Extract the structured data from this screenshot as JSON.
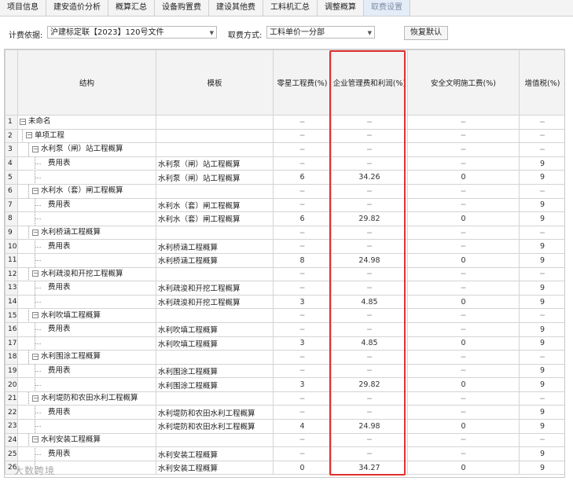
{
  "tabs": [
    "项目信息",
    "建安造价分析",
    "概算汇总",
    "设备购置费",
    "建设其他费",
    "工料机汇总",
    "调整概算",
    "取费设置"
  ],
  "active_tab": 7,
  "toolbar": {
    "basis_label": "计费依据:",
    "basis_value": "沪建标定联【2023】120号文件",
    "method_label": "取费方式:",
    "method_value": "工料单价一分部",
    "restore_button": "恢复默认"
  },
  "table": {
    "headers": [
      "结构",
      "模板",
      "零星工程费(%)",
      "企业管理费和利润(%)",
      "安全文明施工费(%)",
      "增值税(%)"
    ],
    "rows": [
      {
        "n": "1",
        "level": 0,
        "box": "−",
        "name": "未命名",
        "tpl": "",
        "v1": "−",
        "v2": "−",
        "v3": "−",
        "v4": "−"
      },
      {
        "n": "2",
        "level": 1,
        "box": "−",
        "name": "单项工程",
        "tpl": "",
        "v1": "−",
        "v2": "−",
        "v3": "−",
        "v4": "−"
      },
      {
        "n": "3",
        "level": 2,
        "box": "−",
        "name": "水利泵（闸）站工程概算",
        "tpl": "",
        "v1": "−",
        "v2": "−",
        "v3": "−",
        "v4": "−"
      },
      {
        "n": "4",
        "level": 3,
        "box": "",
        "name": "费用表",
        "tpl": "水利泵（闸）站工程概算",
        "v1": "−",
        "v2": "−",
        "v3": "−",
        "v4": "9"
      },
      {
        "n": "5",
        "level": 3,
        "box": "",
        "name": "",
        "tpl": "水利泵（闸）站工程概算",
        "v1": "6",
        "v2": "34.26",
        "v3": "0",
        "v4": "9"
      },
      {
        "n": "6",
        "level": 2,
        "box": "−",
        "name": "水利水（套）闸工程概算",
        "tpl": "",
        "v1": "−",
        "v2": "−",
        "v3": "−",
        "v4": "−"
      },
      {
        "n": "7",
        "level": 3,
        "box": "",
        "name": "费用表",
        "tpl": "水利水（套）闸工程概算",
        "v1": "−",
        "v2": "−",
        "v3": "−",
        "v4": "9"
      },
      {
        "n": "8",
        "level": 3,
        "box": "",
        "name": "",
        "tpl": "水利水（套）闸工程概算",
        "v1": "6",
        "v2": "29.82",
        "v3": "0",
        "v4": "9"
      },
      {
        "n": "9",
        "level": 2,
        "box": "−",
        "name": "水利桥涵工程概算",
        "tpl": "",
        "v1": "−",
        "v2": "−",
        "v3": "−",
        "v4": "−"
      },
      {
        "n": "10",
        "level": 3,
        "box": "",
        "name": "费用表",
        "tpl": "水利桥涵工程概算",
        "v1": "−",
        "v2": "−",
        "v3": "−",
        "v4": "9"
      },
      {
        "n": "11",
        "level": 3,
        "box": "",
        "name": "",
        "tpl": "水利桥涵工程概算",
        "v1": "8",
        "v2": "24.98",
        "v3": "0",
        "v4": "9"
      },
      {
        "n": "12",
        "level": 2,
        "box": "−",
        "name": "水利疏浚和开挖工程概算",
        "tpl": "",
        "v1": "−",
        "v2": "−",
        "v3": "−",
        "v4": "−"
      },
      {
        "n": "13",
        "level": 3,
        "box": "",
        "name": "费用表",
        "tpl": "水利疏浚和开挖工程概算",
        "v1": "−",
        "v2": "−",
        "v3": "−",
        "v4": "9"
      },
      {
        "n": "14",
        "level": 3,
        "box": "",
        "name": "",
        "tpl": "水利疏浚和开挖工程概算",
        "v1": "3",
        "v2": "4.85",
        "v3": "0",
        "v4": "9"
      },
      {
        "n": "15",
        "level": 2,
        "box": "−",
        "name": "水利吹填工程概算",
        "tpl": "",
        "v1": "−",
        "v2": "−",
        "v3": "−",
        "v4": "−"
      },
      {
        "n": "16",
        "level": 3,
        "box": "",
        "name": "费用表",
        "tpl": "水利吹填工程概算",
        "v1": "−",
        "v2": "−",
        "v3": "−",
        "v4": "9"
      },
      {
        "n": "17",
        "level": 3,
        "box": "",
        "name": "",
        "tpl": "水利吹填工程概算",
        "v1": "3",
        "v2": "4.85",
        "v3": "0",
        "v4": "9"
      },
      {
        "n": "18",
        "level": 2,
        "box": "−",
        "name": "水利围涂工程概算",
        "tpl": "",
        "v1": "−",
        "v2": "−",
        "v3": "−",
        "v4": "−"
      },
      {
        "n": "19",
        "level": 3,
        "box": "",
        "name": "费用表",
        "tpl": "水利围涂工程概算",
        "v1": "−",
        "v2": "−",
        "v3": "−",
        "v4": "9"
      },
      {
        "n": "20",
        "level": 3,
        "box": "",
        "name": "",
        "tpl": "水利围涂工程概算",
        "v1": "3",
        "v2": "29.82",
        "v3": "0",
        "v4": "9"
      },
      {
        "n": "21",
        "level": 2,
        "box": "−",
        "name": "水利堤防和农田水利工程概算",
        "tpl": "",
        "v1": "−",
        "v2": "−",
        "v3": "−",
        "v4": "−"
      },
      {
        "n": "22",
        "level": 3,
        "box": "",
        "name": "费用表",
        "tpl": "水利堤防和农田水利工程概算",
        "v1": "−",
        "v2": "−",
        "v3": "−",
        "v4": "9"
      },
      {
        "n": "23",
        "level": 3,
        "box": "",
        "name": "",
        "tpl": "水利堤防和农田水利工程概算",
        "v1": "4",
        "v2": "24.98",
        "v3": "0",
        "v4": "9"
      },
      {
        "n": "24",
        "level": 2,
        "box": "−",
        "name": "水利安装工程概算",
        "tpl": "",
        "v1": "−",
        "v2": "−",
        "v3": "−",
        "v4": "−"
      },
      {
        "n": "25",
        "level": 3,
        "box": "",
        "name": "费用表",
        "tpl": "水利安装工程概算",
        "v1": "−",
        "v2": "−",
        "v3": "−",
        "v4": "9"
      },
      {
        "n": "26",
        "level": 3,
        "box": "",
        "name": "",
        "tpl": "水利安装工程概算",
        "v1": "0",
        "v2": "34.27",
        "v3": "0",
        "v4": "9"
      }
    ]
  },
  "watermark": "大数跨境"
}
